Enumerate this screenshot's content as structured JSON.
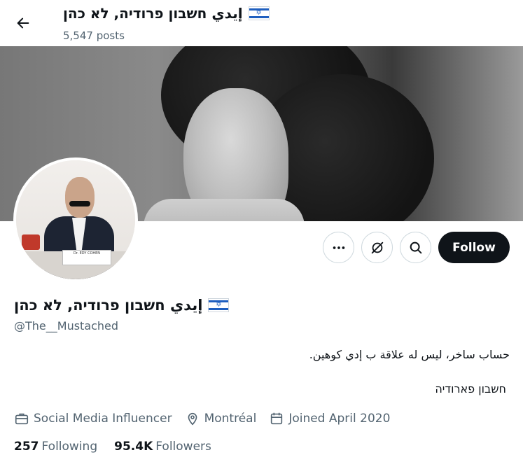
{
  "header": {
    "title": "إيدي חשבון פרודיה, לא כהן",
    "posts": "5,547 posts",
    "back_icon": "back-arrow-icon"
  },
  "profile": {
    "display_name": "إيدي חשבון פרודיה, לא כהן",
    "handle": "@The__Mustached",
    "bio_line1": "حساب ساخر، ليس له علاقة ب إدي كوهين.",
    "bio_line2": "חשבון פארודיה",
    "avatar_plate": "Dr. EDY COHEN",
    "flag_icon": "israel-flag-icon"
  },
  "actions": {
    "more_icon": "more-dots-icon",
    "grok_icon": "grok-icon",
    "search_icon": "search-icon",
    "follow_label": "Follow"
  },
  "meta": {
    "category": "Social Media Influencer",
    "location": "Montréal",
    "joined": "Joined April 2020"
  },
  "stats": {
    "following_count": "257",
    "following_label": "Following",
    "followers_count": "95.4K",
    "followers_label": "Followers"
  },
  "colors": {
    "text_primary": "#0f1419",
    "text_secondary": "#536471",
    "follow_bg": "#0f1419",
    "border": "#cfd9de"
  }
}
